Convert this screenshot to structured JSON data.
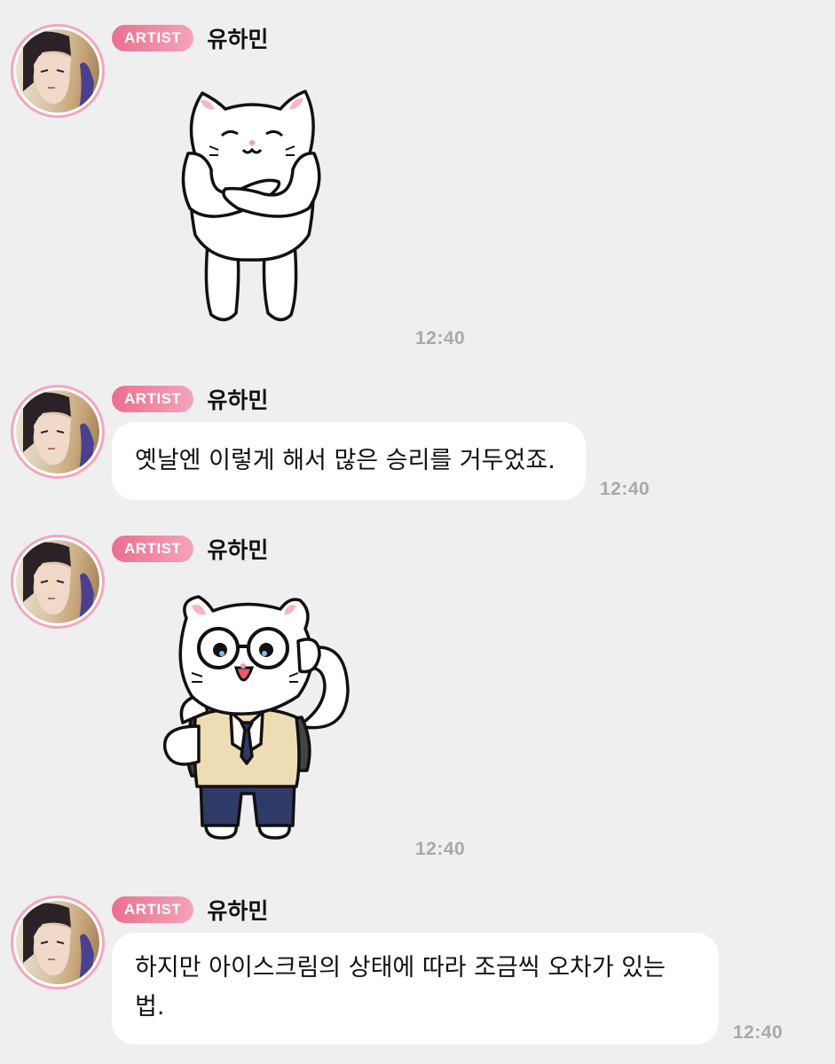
{
  "messages": [
    {
      "type": "sticker",
      "sticker_icon": "cat-arms-crossed-sticker",
      "badge": "ARTIST",
      "sender": "유하민",
      "time": "12:40"
    },
    {
      "type": "text",
      "badge": "ARTIST",
      "sender": "유하민",
      "text": "옛날엔 이렇게 해서 많은 승리를 거두었죠.",
      "time": "12:40"
    },
    {
      "type": "sticker",
      "sticker_icon": "cat-student-glasses-sticker",
      "badge": "ARTIST",
      "sender": "유하민",
      "time": "12:40"
    },
    {
      "type": "text",
      "badge": "ARTIST",
      "sender": "유하민",
      "text_line1": "하지만 아이스크림의 상태에 따라 조금씩 오차가 있는",
      "text_line2": "법.",
      "time": "12:40"
    }
  ],
  "colors": {
    "background": "#efefef",
    "badge_start": "#ea6f8f",
    "badge_end": "#f5a3bc",
    "avatar_ring": "#f3a6bf",
    "timestamp": "#a9a9a9"
  }
}
